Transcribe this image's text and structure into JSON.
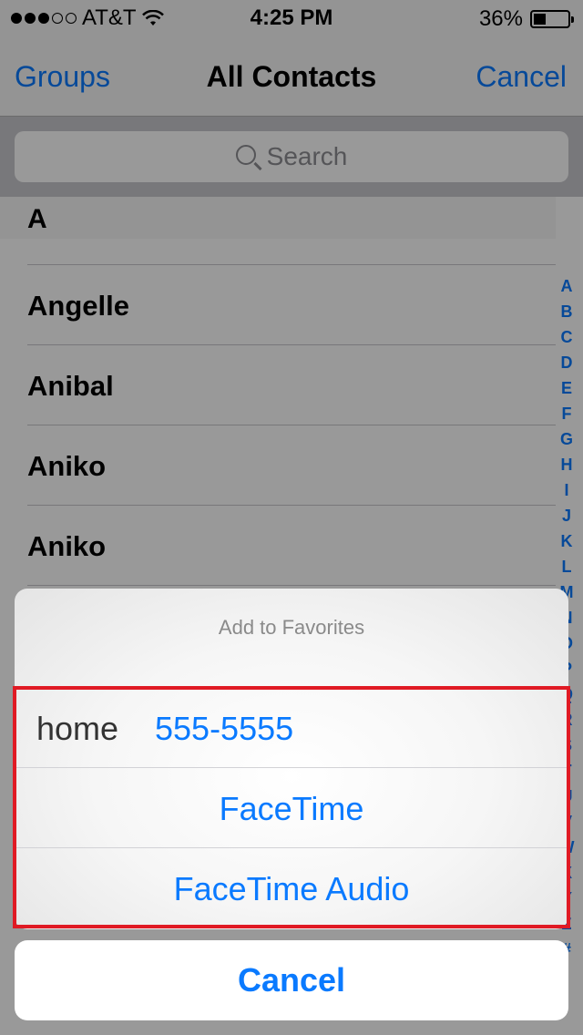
{
  "status_bar": {
    "carrier": "AT&T",
    "time": "4:25 PM",
    "battery_percent": "36%",
    "battery_level": 0.36,
    "signal_bars_on": 3,
    "signal_bars_total": 5,
    "wifi_icon": "wifi-icon"
  },
  "nav": {
    "left_label": "Groups",
    "title": "All Contacts",
    "right_label": "Cancel"
  },
  "search": {
    "placeholder": "Search"
  },
  "section_letter": "A",
  "contacts": [
    "Angelle",
    "Anibal",
    "Aniko",
    "Aniko"
  ],
  "index_letters": [
    "A",
    "B",
    "C",
    "D",
    "E",
    "F",
    "G",
    "H",
    "I",
    "J",
    "K",
    "L",
    "M",
    "N",
    "O",
    "P",
    "Q",
    "R",
    "S",
    "T",
    "U",
    "V",
    "W",
    "X",
    "Y",
    "Z",
    "#"
  ],
  "action_sheet": {
    "title": "Add to Favorites",
    "phone_type": "home",
    "phone_number": "555-5555",
    "facetime_label": "FaceTime",
    "facetime_audio_label": "FaceTime Audio",
    "cancel_label": "Cancel"
  },
  "colors": {
    "accent": "#0a7aff",
    "highlight": "#e01a24"
  }
}
